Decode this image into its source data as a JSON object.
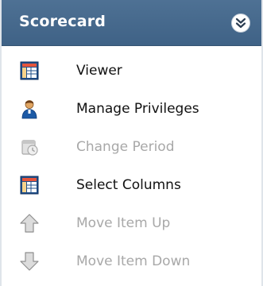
{
  "panel": {
    "title": "Scorecard",
    "collapse_icon": "double-chevron-down-icon",
    "accent_color": "#44688c"
  },
  "menu": {
    "items": [
      {
        "label": "Viewer",
        "icon": "grid-table-icon",
        "enabled": true
      },
      {
        "label": "Manage Privileges",
        "icon": "person-icon",
        "enabled": true
      },
      {
        "label": "Change Period",
        "icon": "period-calendar-icon",
        "enabled": false
      },
      {
        "label": "Select Columns",
        "icon": "grid-table-icon",
        "enabled": true
      },
      {
        "label": "Move Item Up",
        "icon": "arrow-up-icon",
        "enabled": false
      },
      {
        "label": "Move Item Down",
        "icon": "arrow-down-icon",
        "enabled": false
      }
    ]
  }
}
